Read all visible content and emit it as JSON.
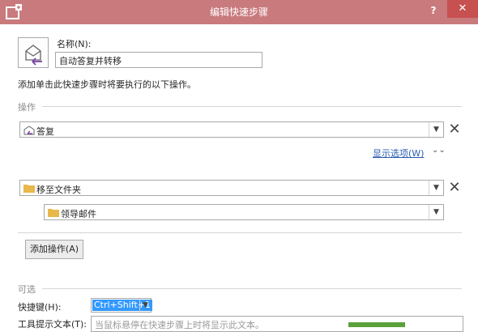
{
  "window": {
    "title": "编辑快速步骤",
    "help_label": "?",
    "close_label": "✕"
  },
  "name": {
    "label": "名称(N):",
    "value": "自动答复并转移"
  },
  "instruction": "添加单击此快速步骤时将要执行的以下操作。",
  "actions_section": {
    "label": "操作",
    "action1": {
      "text": "答复",
      "remove": "✕"
    },
    "show_options": "显示选项(W)",
    "expand_icon": "chevron-double-down-icon",
    "action2": {
      "text": "移至文件夹",
      "remove": "✕",
      "folder": "领导邮件"
    },
    "add_action": "添加操作(A)"
  },
  "optional_section": {
    "label": "可选",
    "shortcut_label": "快捷键(H):",
    "shortcut_value": "Ctrl+Shift+1",
    "tooltip_label": "工具提示文本(T):",
    "tooltip_placeholder": "当鼠标悬停在快速步骤上时将显示此文本。"
  },
  "colors": {
    "titlebar": "#c97a7d",
    "close": "#c75050",
    "link": "#2a5db0",
    "selection": "#3399ff"
  }
}
